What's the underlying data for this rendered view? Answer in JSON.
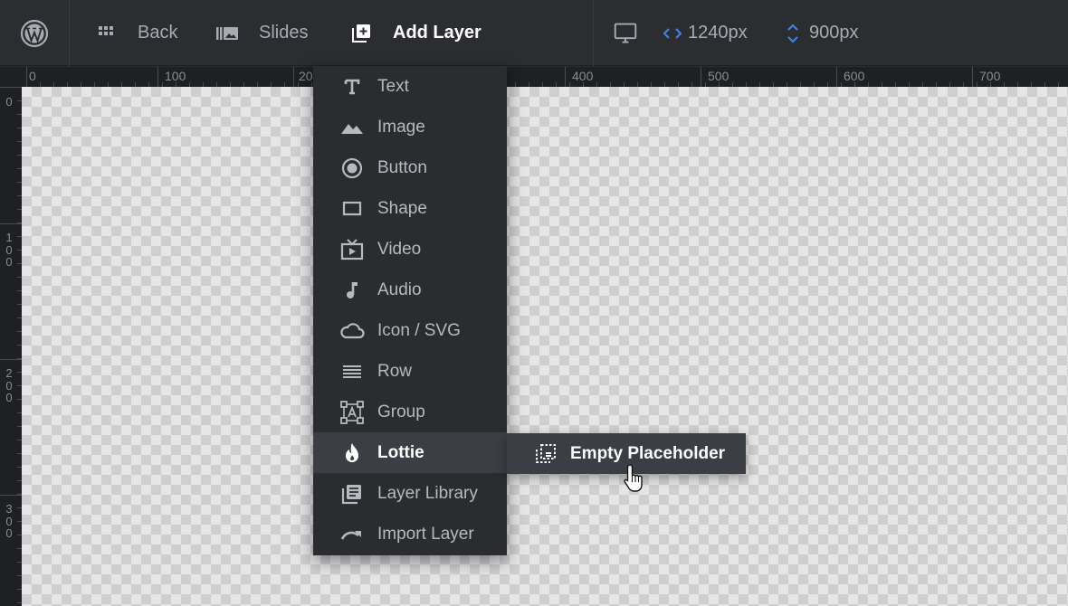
{
  "toolbar": {
    "logo_icon": "wordpress-icon",
    "back_label": "Back",
    "back_icon": "grid-icon",
    "slides_label": "Slides",
    "slides_icon": "slides-library-icon",
    "add_layer_label": "Add Layer",
    "add_layer_icon": "add-layer-icon",
    "device_icon": "desktop-icon",
    "width_value": "1240px",
    "width_icon": "code-arrows-icon",
    "height_value": "900px",
    "height_icon": "vertical-arrows-icon"
  },
  "ruler": {
    "top_labels": [
      "0",
      "100",
      "20",
      "400",
      "500",
      "600",
      "700"
    ],
    "left_labels": [
      "0",
      "1\n0\n0",
      "2\n0\n0",
      "3\n0\n0"
    ]
  },
  "menu": {
    "items": [
      {
        "label": "Text",
        "icon": "text-icon"
      },
      {
        "label": "Image",
        "icon": "image-mountain-icon"
      },
      {
        "label": "Button",
        "icon": "radio-button-icon"
      },
      {
        "label": "Shape",
        "icon": "rectangle-icon"
      },
      {
        "label": "Video",
        "icon": "tv-play-icon"
      },
      {
        "label": "Audio",
        "icon": "music-note-icon"
      },
      {
        "label": "Icon / SVG",
        "icon": "cloud-icon"
      },
      {
        "label": "Row",
        "icon": "rows-icon"
      },
      {
        "label": "Group",
        "icon": "group-text-icon"
      },
      {
        "label": "Lottie",
        "icon": "flame-icon"
      },
      {
        "label": "Layer Library",
        "icon": "library-icon"
      },
      {
        "label": "Import Layer",
        "icon": "redo-arrow-icon"
      }
    ],
    "active_index": 9
  },
  "submenu": {
    "label": "Empty Placeholder",
    "icon": "dashed-placeholder-icon"
  },
  "colors": {
    "accent_blue": "#3f83e0",
    "ruler_marker": "#d6356b",
    "toolbar_bg": "#2c2d31",
    "menu_hover_bg": "#3c3e45"
  }
}
